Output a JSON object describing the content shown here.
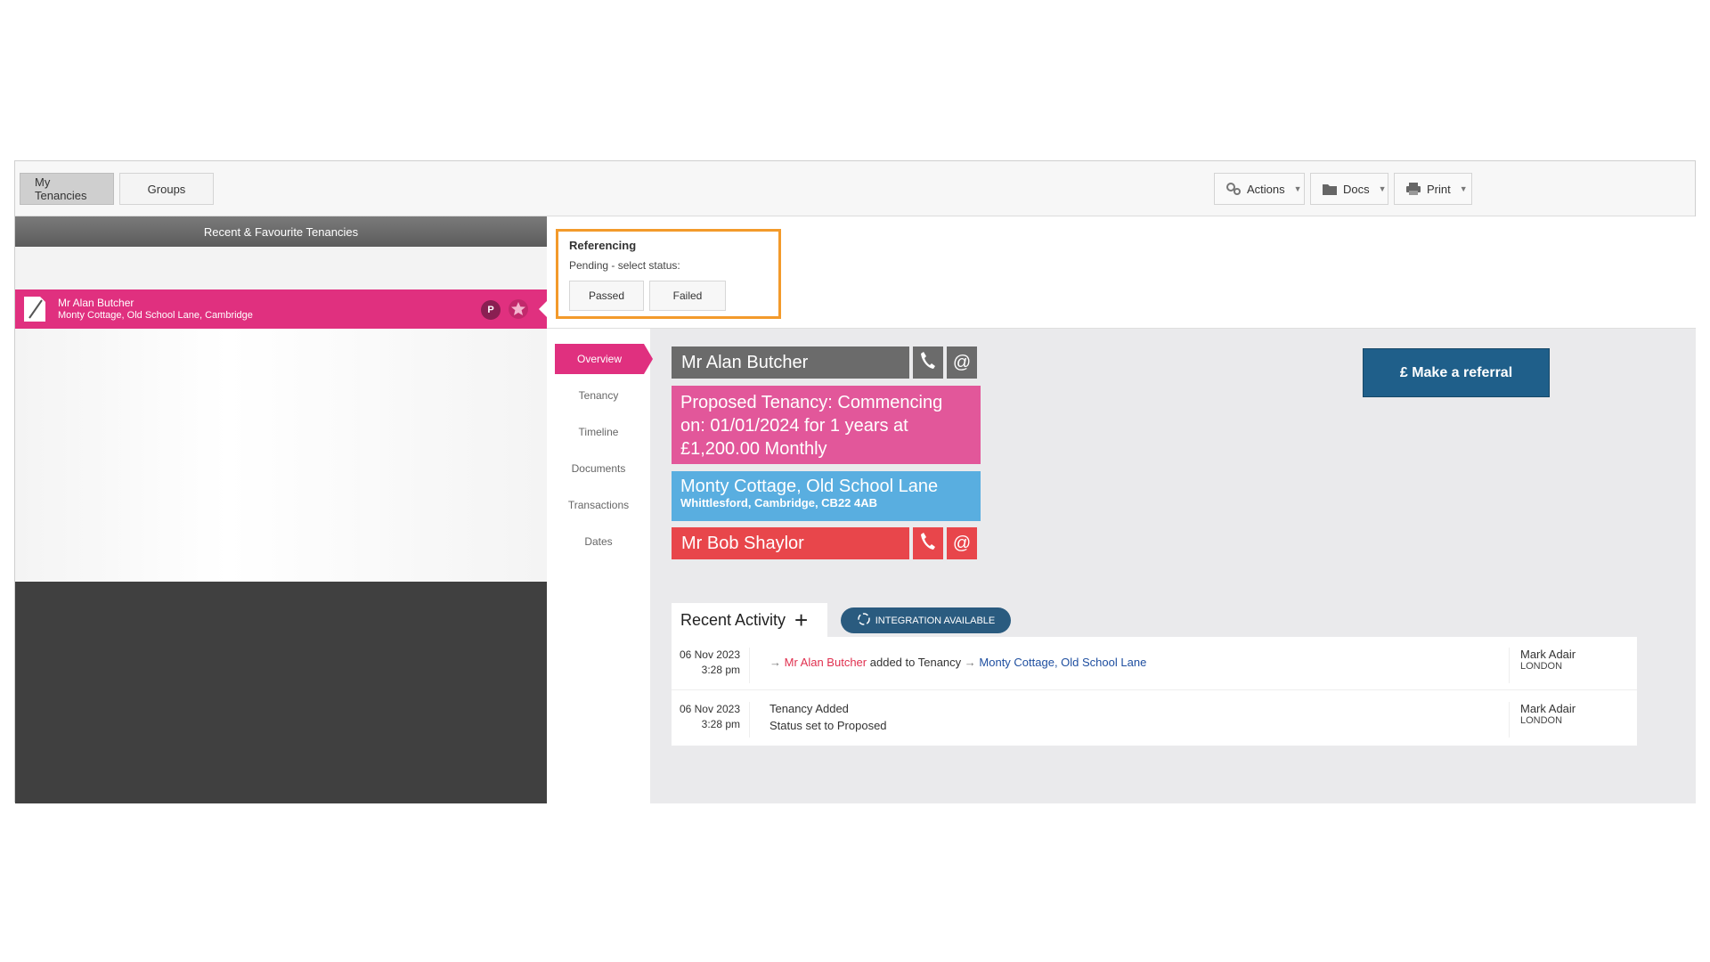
{
  "topbar": {
    "tabs": [
      {
        "label": "My Tenancies",
        "active": true
      },
      {
        "label": "Groups",
        "active": false
      }
    ],
    "actions_label": "Actions",
    "docs_label": "Docs",
    "print_label": "Print"
  },
  "left_panel": {
    "header": "Recent & Favourite Tenancies",
    "tenancy": {
      "name": "Mr Alan Butcher",
      "address": "Monty Cottage, Old School Lane, Cambridge",
      "badge": "P"
    }
  },
  "referencing": {
    "title": "Referencing",
    "subtitle": "Pending - select status:",
    "passed_label": "Passed",
    "failed_label": "Failed"
  },
  "subnav": [
    "Overview",
    "Tenancy",
    "Timeline",
    "Documents",
    "Transactions",
    "Dates"
  ],
  "overview": {
    "tenant_name": "Mr Alan Butcher",
    "tenancy_text": "Proposed Tenancy: Commencing on: 01/01/2024 for 1 years at £1,200.00 Monthly",
    "property_line1": "Monty Cottage, Old School Lane",
    "property_line2": "Whittlesford, Cambridge, CB22 4AB",
    "landlord_name": "Mr Bob Shaylor",
    "referral_label": "£ Make a referral",
    "at_symbol": "@"
  },
  "recent_activity": {
    "title": "Recent Activity",
    "plus": "+",
    "integration_label": "INTEGRATION AVAILABLE",
    "rows": [
      {
        "date": "06 Nov 2023",
        "time": "3:28 pm",
        "person": "Mr Alan Butcher",
        "action": "added to Tenancy",
        "property": "Monty Cottage, Old School Lane",
        "user": "Mark Adair",
        "location": "LONDON"
      },
      {
        "date": "06 Nov 2023",
        "time": "3:28 pm",
        "line1": "Tenancy Added",
        "line2": "Status set to Proposed",
        "user": "Mark Adair",
        "location": "LONDON"
      }
    ]
  },
  "colors": {
    "pink": "#e0307f",
    "grey_card": "#6b6b6b",
    "blue_card": "#59aee0",
    "red_card": "#e8464b",
    "referral": "#1f5f8a",
    "highlight": "#f39a2b"
  }
}
